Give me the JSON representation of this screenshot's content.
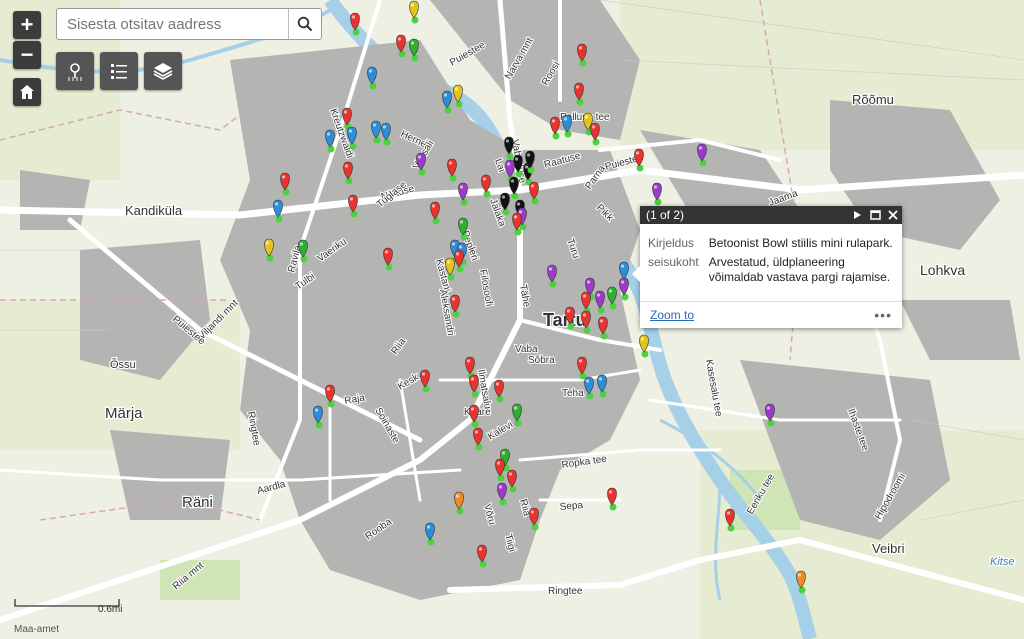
{
  "search": {
    "placeholder": "Sisesta otsitav aadress"
  },
  "controls": {
    "zoom_in_label": "+",
    "zoom_out_label": "−"
  },
  "popup": {
    "counter": "(1 of 2)",
    "fields": [
      {
        "key": "Kirjeldus",
        "value": "Betoonist Bowl stiilis mini rulapark."
      },
      {
        "key": "seisukoht",
        "value": "Arvestatud, üldplaneering võimaldab vastava pargi rajamise."
      }
    ],
    "zoom_link": "Zoom to",
    "more": "•••"
  },
  "scale": {
    "label": "0.6mi"
  },
  "attribution": "Maa-amet",
  "map_labels": {
    "city": "Tartu",
    "districts": [
      "Kandiküla",
      "Õssu",
      "Märja",
      "Räni",
      "Rõõmu",
      "Lohkva",
      "Veibri",
      "Kitse"
    ],
    "streets": [
      "Puiestee",
      "Narva mnt",
      "Roosi",
      "Raatuse",
      "Pikk",
      "Puiestee",
      "Parna",
      "Jaama",
      "Herne",
      "Kreutzwaldi",
      "Lai",
      "Vabaduse",
      "Näituse",
      "Vaksali",
      "Kastani",
      "Pepleri",
      "Filosoofi",
      "Tähe",
      "Turu",
      "Vaba",
      "Sõbra",
      "Teha",
      "Riia",
      "Kesk",
      "Kaare",
      "Kalevi",
      "Ropka tee",
      "Sepa",
      "Võru",
      "Aardla",
      "Rooba",
      "Ringtee",
      "Ringtee",
      "Riia mnt",
      "Viljandi mnt",
      "Raja",
      "Soinaste",
      "Tuglase",
      "Vaeriku",
      "Tulbi",
      "Ravila",
      "Puiestee",
      "Eeriku tee",
      "Hipodroomi",
      "Kasesalu tee",
      "Ihaste tee",
      "Palluse tee",
      "Ilmatsalu",
      "Tiigi",
      "Riia",
      "Aleksandri",
      "Jalaka",
      "Kastani",
      "Ülikooli"
    ]
  },
  "colors": {
    "land": "#eef0e4",
    "block": "#b4b4b2",
    "road": "#ffffff",
    "water": "#a6cfe8",
    "green": "#cfe5b5",
    "marker_red": "#e8332e",
    "marker_blue": "#2a8fd8",
    "marker_green": "#2fae34",
    "marker_purple": "#9b3bc9",
    "marker_black": "#111111",
    "marker_yellow": "#e3c31c",
    "marker_orange": "#ef8b22",
    "shadow_green": "#4cd13f"
  },
  "icons": [
    "zoom-in-icon",
    "zoom-out-icon",
    "home-icon",
    "locate-icon",
    "legend-icon",
    "layers-icon",
    "search-icon",
    "play-icon",
    "maximize-icon",
    "close-icon"
  ]
}
